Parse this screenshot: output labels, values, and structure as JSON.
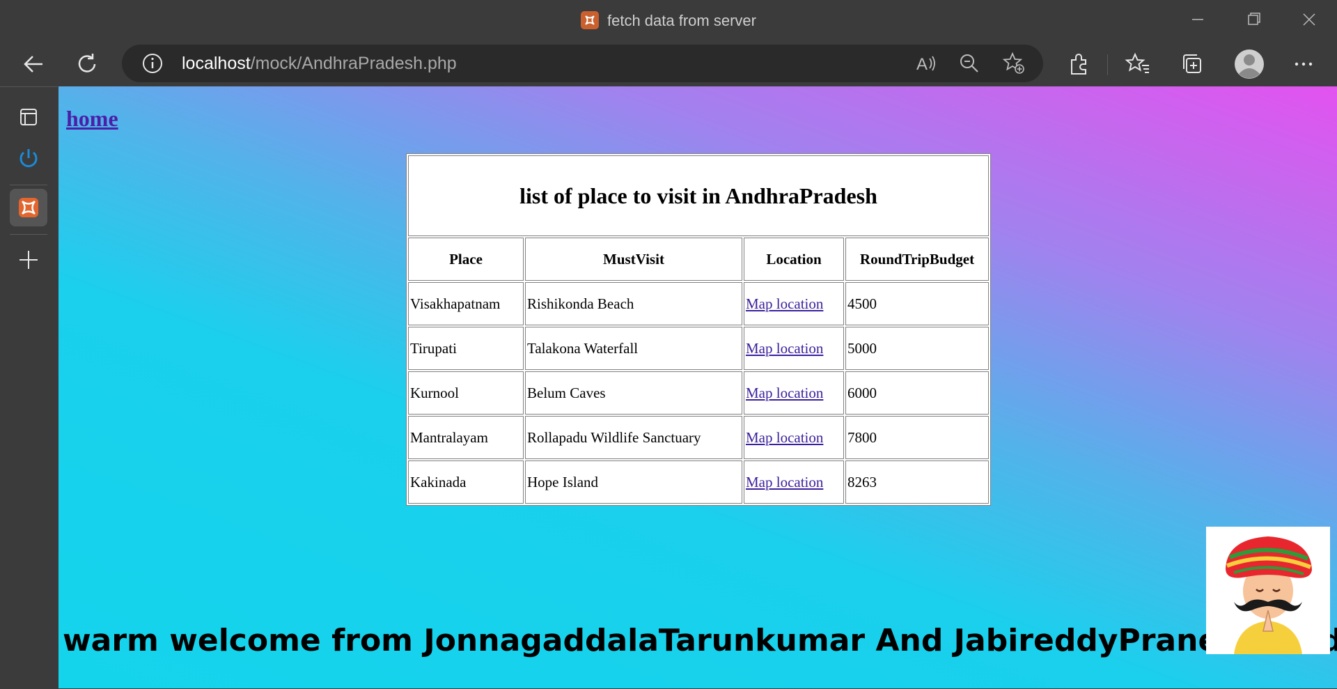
{
  "window": {
    "title": "fetch data from server"
  },
  "toolbar": {
    "url_host": "localhost",
    "url_path": "/mock/AndhraPradesh.php"
  },
  "page": {
    "home_link": "home",
    "table": {
      "caption": "list of place to visit in AndhraPradesh",
      "headers": [
        "Place",
        "MustVisit",
        "Location",
        "RoundTripBudget"
      ],
      "rows": [
        {
          "place": "Visakhapatnam",
          "must_visit": "Rishikonda Beach",
          "location": "Map location",
          "budget": "4500"
        },
        {
          "place": "Tirupati",
          "must_visit": "Talakona Waterfall",
          "location": "Map location",
          "budget": "5000"
        },
        {
          "place": "Kurnool",
          "must_visit": "Belum Caves",
          "location": "Map location",
          "budget": "6000"
        },
        {
          "place": "Mantralayam",
          "must_visit": "Rollapadu Wildlife Sanctuary",
          "location": "Map location",
          "budget": "7800"
        },
        {
          "place": "Kakinada",
          "must_visit": "Hope Island",
          "location": "Map location",
          "budget": "8263"
        }
      ]
    },
    "welcome_text": "warm welcome from JonnagaddalaTarunkumar And JabireddyPraneethReddy"
  },
  "colors": {
    "browser_chrome": "#3b3b3b",
    "address_bar": "#2a2a2a",
    "link": "#4b1fa8",
    "gradient_top_right": "#e352ef",
    "gradient_bottom": "#14d4ec"
  },
  "icons": {
    "titlebar": [
      "app-icon",
      "minimize-icon",
      "maximize-icon",
      "close-icon"
    ],
    "toolbar": [
      "back-icon",
      "refresh-icon",
      "site-info-icon",
      "read-aloud-icon",
      "zoom-out-icon",
      "add-favorite-icon",
      "extensions-icon",
      "favorites-icon",
      "collections-icon",
      "profile-icon",
      "more-icon"
    ],
    "sidebar": [
      "tab-actions-icon",
      "power-icon",
      "app-tab-icon",
      "add-icon"
    ]
  }
}
